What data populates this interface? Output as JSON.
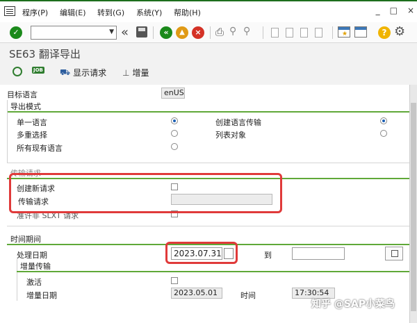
{
  "menu": {
    "items": [
      "程序(P)",
      "编辑(E)",
      "转到(G)",
      "系统(Y)",
      "帮助(H)"
    ],
    "window_controls": [
      "_",
      "□",
      "×"
    ]
  },
  "toolbar": {
    "command_field": "",
    "icons": [
      "check-icon",
      "back-double-icon",
      "save-icon",
      "back-icon",
      "exit-icon",
      "cancel-icon",
      "print-icon",
      "find-icon",
      "find-next-icon",
      "first-page-icon",
      "prev-page-icon",
      "next-page-icon",
      "last-page-icon",
      "create-session-icon",
      "shortcut-icon",
      "help-icon",
      "settings-icon"
    ],
    "help_glyph": "?"
  },
  "title": "SE63 翻译导出",
  "app_toolbar": {
    "job_badge": "JOB",
    "show_request": "显示请求",
    "delta": "增量"
  },
  "form": {
    "target_language_label": "目标语言",
    "target_language_value": "enUS",
    "export_mode": {
      "title": "导出模式",
      "single_language": "单一语言",
      "multi_select": "多重选择",
      "all_languages": "所有现有语言",
      "create_language_transport": "创建语言传输",
      "list_objects": "列表对象",
      "selected": [
        "single_language",
        "create_language_transport"
      ]
    },
    "transport_request": {
      "title": "传输请求",
      "create_new": "创建新请求",
      "transport_request": "传输请求",
      "allow_non_slxt": "准许非 SLXT 请求"
    },
    "period": {
      "title": "时间期间",
      "processing_date": "处理日期",
      "date_from": "2023.07.31",
      "to_label": "到",
      "date_to": ""
    },
    "delta_transfer": {
      "title": "增量传输",
      "activate": "激活",
      "delta_date_label": "增量日期",
      "delta_date_value": "2023.05.01",
      "time_label": "时间",
      "time_value": "17:30:54"
    }
  },
  "watermark": "知乎 @SAP小菜鸟",
  "colors": {
    "sap_green": "#1b8a1b",
    "section_rule": "#5fa838",
    "highlight": "#e03a3a"
  }
}
